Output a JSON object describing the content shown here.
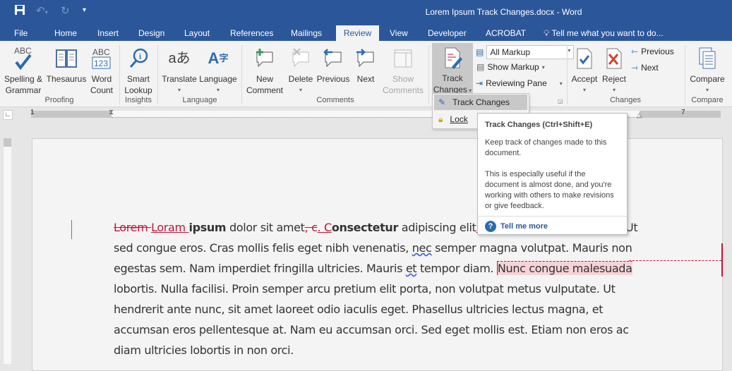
{
  "window": {
    "title": "Lorem Ipsum Track Changes.docx - Word"
  },
  "qat": {
    "save": "save-icon",
    "undo": "undo-icon",
    "redo": "redo-icon",
    "customize": "customize-icon"
  },
  "tabs": [
    "File",
    "Home",
    "Insert",
    "Design",
    "Layout",
    "References",
    "Mailings",
    "Review",
    "View",
    "Developer",
    "ACROBAT"
  ],
  "tell_me": "Tell me what you want to do...",
  "ribbon": {
    "proofing": {
      "label": "Proofing",
      "spelling": "Spelling &",
      "spelling2": "Grammar",
      "thesaurus": "Thesaurus",
      "word": "Word",
      "count": "Count"
    },
    "insights": {
      "label": "Insights",
      "smart": "Smart",
      "lookup": "Lookup"
    },
    "language": {
      "label": "Language",
      "translate": "Translate",
      "language": "Language"
    },
    "comments": {
      "label": "Comments",
      "new": "New",
      "comment": "Comment",
      "delete": "Delete",
      "previous": "Previous",
      "next": "Next",
      "show": "Show",
      "comments": "Comments"
    },
    "tracking": {
      "track": "Track",
      "changes": "Changes",
      "markup_select": "All Markup",
      "show_markup": "Show Markup",
      "reviewing_pane": "Reviewing Pane"
    },
    "changes": {
      "label": "Changes",
      "accept": "Accept",
      "reject": "Reject",
      "previous": "Previous",
      "next": "Next"
    },
    "compare": {
      "label": "Compare",
      "compare": "Compare"
    }
  },
  "menu": {
    "track_changes": "Track Changes",
    "lock": "Lock"
  },
  "tooltip": {
    "title": "Track Changes (Ctrl+Shift+E)",
    "p1": "Keep track of changes made to this document.",
    "p2": "This is especially useful if the document is almost done, and you're working with others to make revisions or give feedback.",
    "link": "Tell me more"
  },
  "ruler": {
    "left_num": "1",
    "right_num": "7"
  },
  "doc": {
    "l1": {
      "del1": "Lorem ",
      "ins1": "Loram ",
      "b1": "ipsum",
      "t1": " dolor sit amet",
      "del2": ", c",
      "ins2": ". C",
      "b2": "onsectetur",
      "t2": " adipiscing elit",
      "ins3": "!",
      "del3": ".",
      "t3": " P",
      "t4": "Ut"
    },
    "l2": {
      "a": "sed congue eros. Cras mollis felis eget nibh venenatis, ",
      "sq": "nec",
      "b": " semper magna volutpat. Mauris non"
    },
    "l3": {
      "a": "egestas sem. Nam imperdiet fringilla ultricies. Mauris ",
      "sq": "et",
      "b": " tempor diam. ",
      "hl": "Nunc congue malesuada"
    },
    "l4": "lobortis. Nulla facilisi. Proin semper arcu pretium elit porta, non volutpat metus vulputate. Ut",
    "l5": "hendrerit ante nunc, sit amet laoreet odio iaculis eget. Phasellus ultricies lectus magna, et",
    "l6": "accumsan eros pellentesque at. Nam eu accumsan orci. Sed eget mollis est. Etiam non eros ac",
    "l7": "diam ultricies lobortis in non orci."
  },
  "colors": {
    "brand": "#2b579a",
    "revision": "#c0143c",
    "highlight": "#f6d3d8"
  }
}
